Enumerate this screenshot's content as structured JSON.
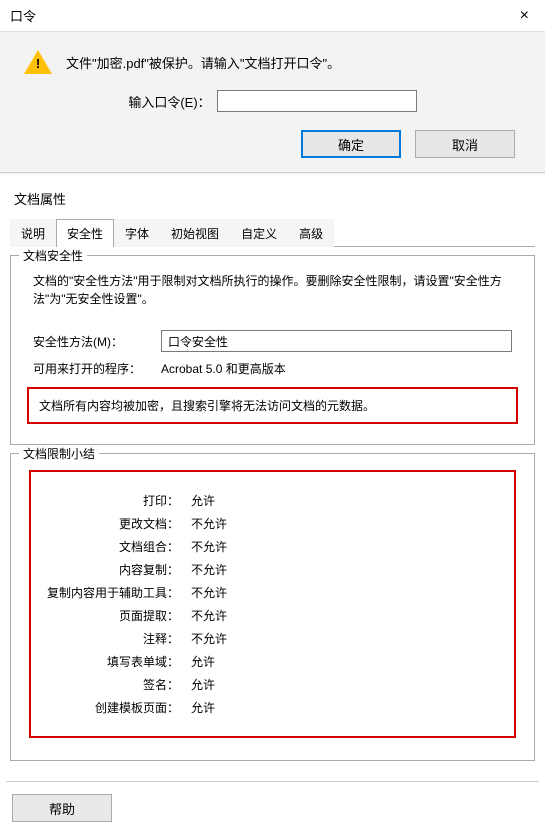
{
  "dialog": {
    "title": "口令",
    "message": "文件\"加密.pdf\"被保护。请输入\"文档打开口令\"。",
    "input_label": "输入口令(E)：",
    "input_value": "",
    "ok": "确定",
    "cancel": "取消"
  },
  "props": {
    "title": "文档属性",
    "tabs": [
      "说明",
      "安全性",
      "字体",
      "初始视图",
      "自定义",
      "高级"
    ],
    "active_tab": "安全性",
    "security": {
      "legend": "文档安全性",
      "desc": "文档的\"安全性方法\"用于限制对文档所执行的操作。要删除安全性限制，请设置\"安全性方法\"为\"无安全性设置\"。",
      "method_label": "安全性方法(M)：",
      "method_value": "口令安全性",
      "open_label": "可用来打开的程序：",
      "open_value": "Acrobat 5.0 和更高版本",
      "alert": "文档所有内容均被加密，且搜索引擎将无法访问文档的元数据。"
    },
    "restrict": {
      "legend": "文档限制小结",
      "rows": [
        {
          "label": "打印：",
          "value": "允许"
        },
        {
          "label": "更改文档：",
          "value": "不允许"
        },
        {
          "label": "文档组合：",
          "value": "不允许"
        },
        {
          "label": "内容复制：",
          "value": "不允许"
        },
        {
          "label": "复制内容用于辅助工具：",
          "value": "不允许"
        },
        {
          "label": "页面提取：",
          "value": "不允许"
        },
        {
          "label": "注释：",
          "value": "不允许"
        },
        {
          "label": "填写表单域：",
          "value": "允许"
        },
        {
          "label": "签名：",
          "value": "允许"
        },
        {
          "label": "创建模板页面：",
          "value": "允许"
        }
      ]
    },
    "help": "帮助"
  }
}
